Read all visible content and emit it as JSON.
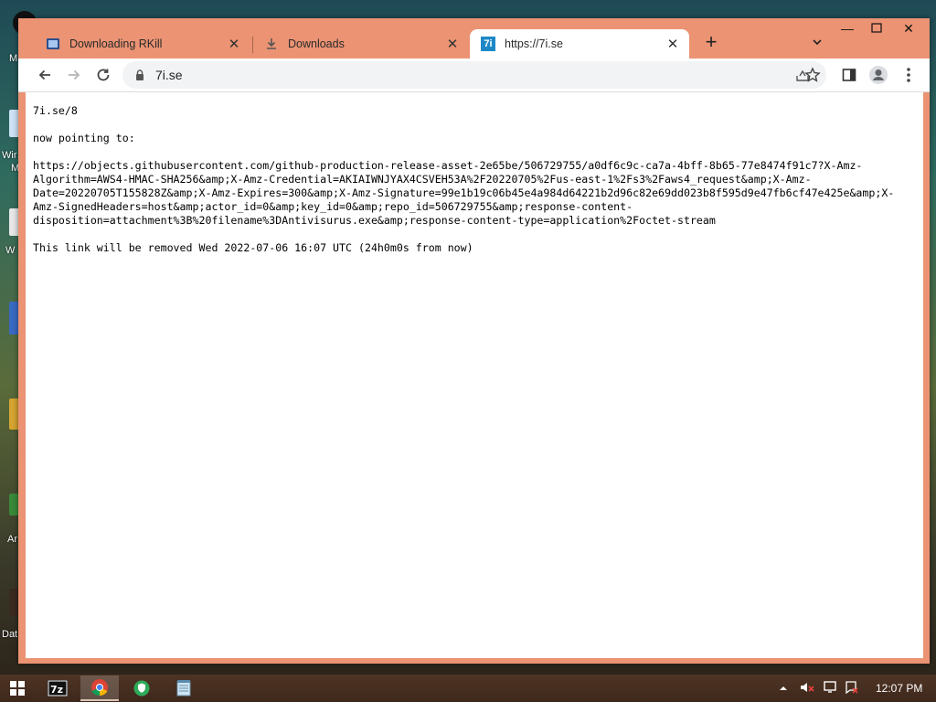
{
  "desktop": {
    "labels": [
      "M",
      "Wir",
      "M",
      "W",
      "Ar",
      "Dat"
    ]
  },
  "browser": {
    "tabs": [
      {
        "title": "Downloading RKill",
        "icon": "rkill-icon"
      },
      {
        "title": "Downloads",
        "icon": "download-icon"
      },
      {
        "title": "https://7i.se",
        "icon": "7i-favicon",
        "favicon_text": "7i",
        "active": true
      }
    ],
    "address": "7i.se",
    "accent": "#eb9373"
  },
  "page": {
    "line1": "7i.se/8",
    "line2": "now pointing to:",
    "url_lines": [
      "https://objects.githubusercontent.com/github-production-release-asset-2e65be/506729755/a0df6c9c-ca7a-4bff-8b65-77e8474f91c7?X-Amz-",
      "Algorithm=AWS4-HMAC-SHA256&amp;X-Amz-Credential=AKIAIWNJYAX4CSVEH53A%2F20220705%2Fus-east-1%2Fs3%2Faws4_request&amp;X-Amz-",
      "Date=20220705T155828Z&amp;X-Amz-Expires=300&amp;X-Amz-Signature=99e1b19c06b45e4a984d64221b2d96c82e69dd023b8f595d9e47fb6cf47e425e&amp;X-",
      "Amz-SignedHeaders=host&amp;actor_id=0&amp;key_id=0&amp;repo_id=506729755&amp;response-content-",
      "disposition=attachment%3B%20filename%3DAntivisurus.exe&amp;response-content-type=application%2Foctet-stream"
    ],
    "notice": "This link will be removed Wed 2022-07-06 16:07 UTC (24h0m0s from now)"
  },
  "taskbar": {
    "items": [
      "7zip-icon",
      "chrome-icon",
      "shield-app-icon",
      "notepad-icon"
    ],
    "time": "12:07 PM"
  }
}
